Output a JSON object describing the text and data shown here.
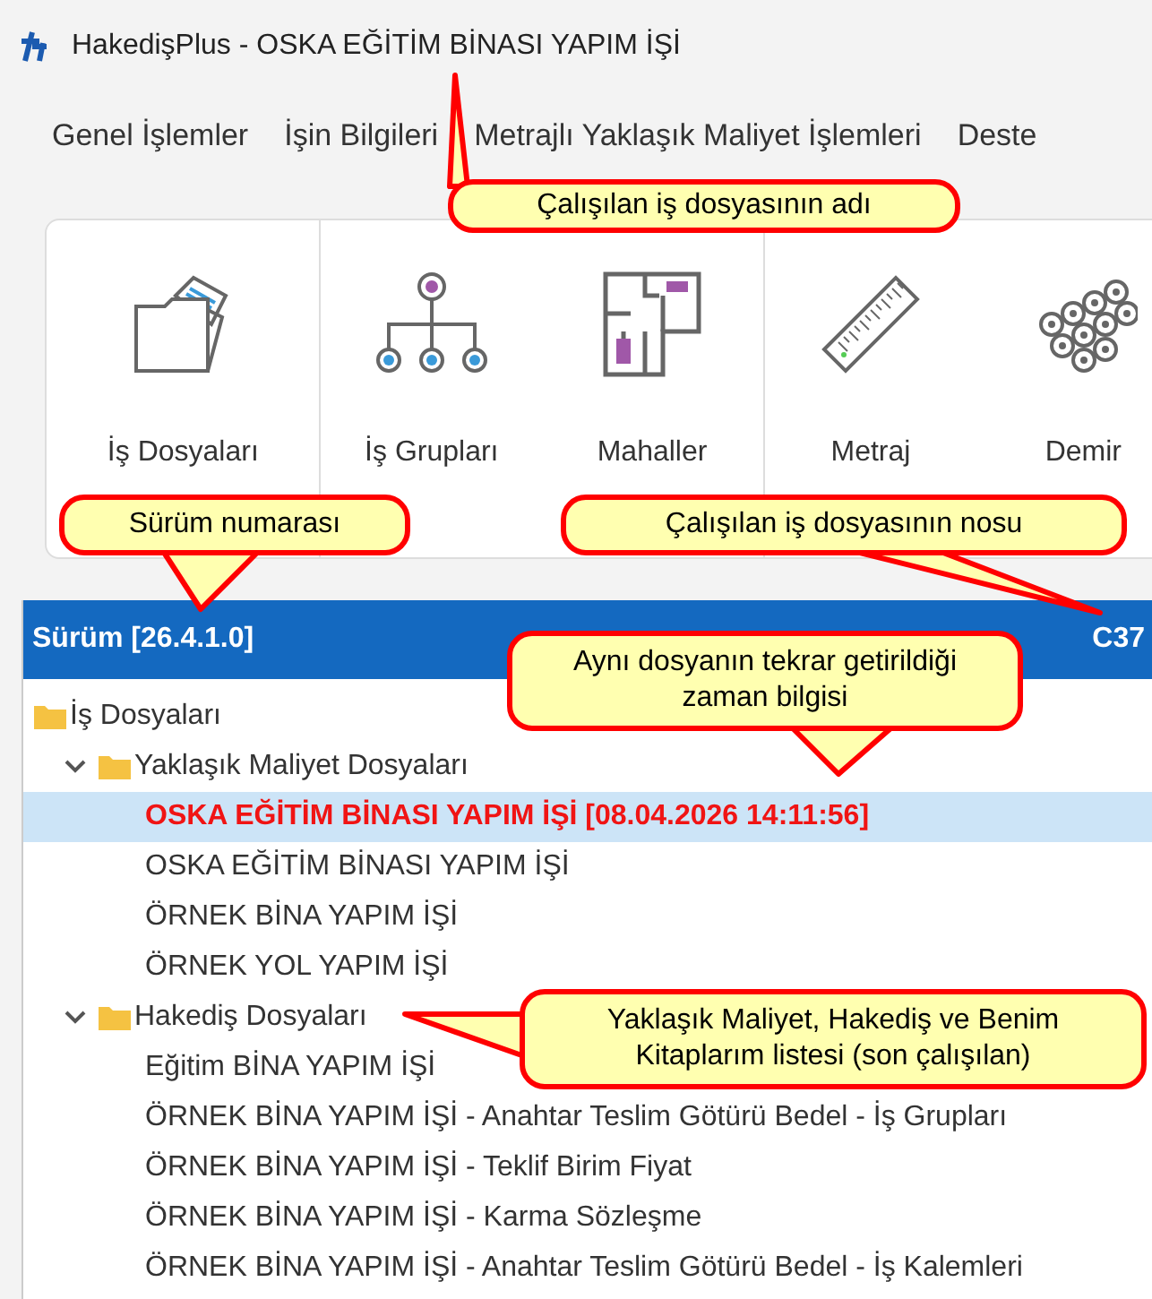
{
  "window": {
    "title": "HakedişPlus - OSKA EĞİTİM BİNASI YAPIM İŞİ"
  },
  "menu": [
    "Genel İşlemler",
    "İşin Bilgileri",
    "Metrajlı Yaklaşık Maliyet İşlemleri",
    "Deste"
  ],
  "ribbon": {
    "groups": [
      {
        "buttons": [
          {
            "label": "İş Dosyaları"
          }
        ]
      },
      {
        "buttons": [
          {
            "label": "İş Grupları"
          },
          {
            "label": "Mahaller"
          }
        ]
      },
      {
        "buttons": [
          {
            "label": "Metraj"
          },
          {
            "label": "Demir"
          }
        ]
      }
    ]
  },
  "tree": {
    "header": {
      "version": "Sürüm [26.4.1.0]",
      "file_no": "C37"
    },
    "items": [
      {
        "label": "İş Dosyaları",
        "children": [
          {
            "label": "Yaklaşık Maliyet Dosyaları",
            "expanded": true,
            "children": [
              {
                "label": "OSKA EĞİTİM BİNASI YAPIM İŞİ [08.04.2026 14:11:56]",
                "selected": true
              },
              {
                "label": "OSKA EĞİTİM BİNASI YAPIM İŞİ",
                "selected": false
              },
              {
                "label": "ÖRNEK BİNA YAPIM İŞİ",
                "selected": false
              },
              {
                "label": "ÖRNEK YOL YAPIM İŞİ",
                "selected": false
              }
            ]
          },
          {
            "label": "Hakediş Dosyaları",
            "expanded": true,
            "children": [
              {
                "label": "Eğitim BİNA YAPIM İŞİ",
                "selected": false
              },
              {
                "label": "ÖRNEK BİNA YAPIM İŞİ - Anahtar Teslim Götürü Bedel - İş Grupları",
                "selected": false
              },
              {
                "label": "ÖRNEK BİNA YAPIM İŞİ - Teklif Birim Fiyat",
                "selected": false
              },
              {
                "label": "ÖRNEK BİNA YAPIM İŞİ - Karma Sözleşme",
                "selected": false
              },
              {
                "label": "ÖRNEK BİNA YAPIM İŞİ - Anahtar Teslim Götürü Bedel - İş Kalemleri",
                "selected": false
              }
            ]
          }
        ]
      }
    ]
  },
  "callouts": [
    "Çalışılan iş dosyasının adı",
    "Sürüm numarası",
    "Çalışılan iş dosyasının nosu",
    "Aynı dosyanın tekrar getirildiği zaman bilgisi",
    "Yaklaşık Maliyet, Hakediş ve Benim Kitaplarım listesi (son çalışılan)"
  ]
}
